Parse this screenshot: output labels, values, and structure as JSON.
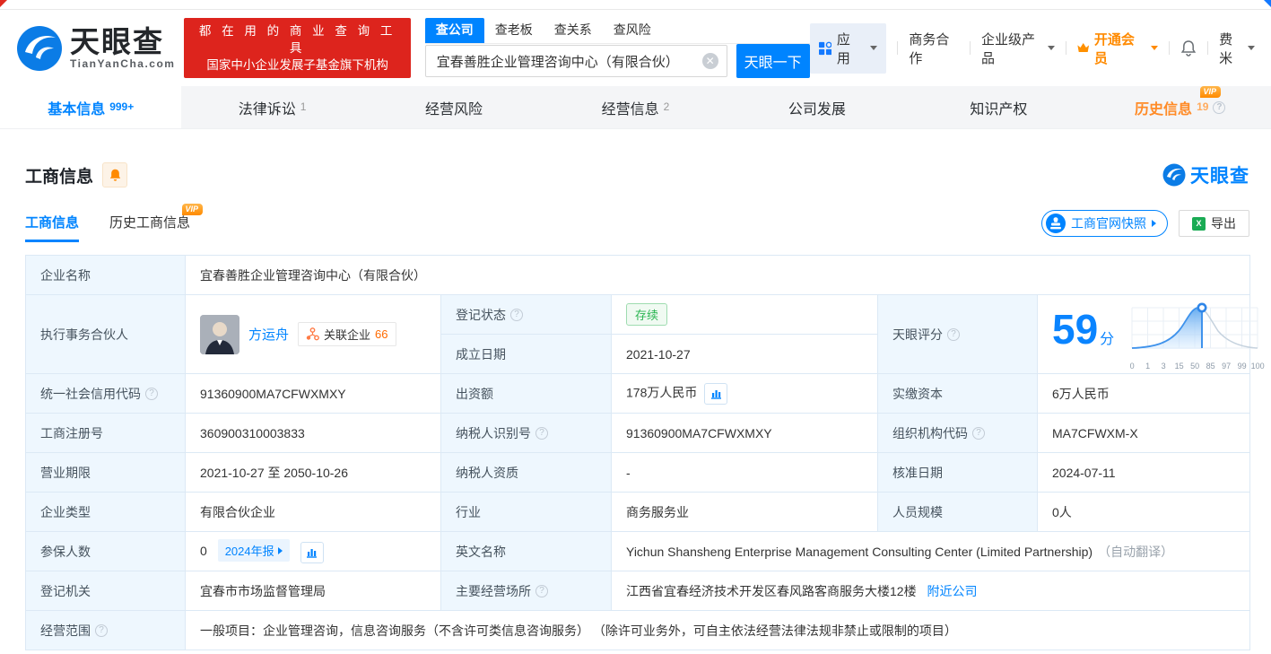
{
  "brand": {
    "name": "天眼查",
    "domain": "TianYanCha.com",
    "slogan_line1": "都 在 用 的 商 业 查 询 工 具",
    "slogan_line2": "国家中小企业发展子基金旗下机构"
  },
  "search": {
    "tabs": [
      {
        "label": "查公司"
      },
      {
        "label": "查老板"
      },
      {
        "label": "查关系"
      },
      {
        "label": "查风险"
      }
    ],
    "active_tab": "查公司",
    "value": "宜春善胜企业管理咨询中心（有限合伙）",
    "button": "天眼一下"
  },
  "topnav": {
    "apps": "应用",
    "cooperation": "商务合作",
    "enterprise_products": "企业级产品",
    "vip": "开通会员",
    "user": "费米"
  },
  "main_tabs": [
    {
      "label": "基本信息",
      "count": "999+"
    },
    {
      "label": "法律诉讼",
      "count": "1"
    },
    {
      "label": "经营风险",
      "count": ""
    },
    {
      "label": "经营信息",
      "count": "2"
    },
    {
      "label": "公司发展",
      "count": ""
    },
    {
      "label": "知识产权",
      "count": ""
    },
    {
      "label": "历史信息",
      "count": "19",
      "vip": "VIP"
    }
  ],
  "section": {
    "title": "工商信息",
    "subtabs": [
      {
        "label": "工商信息"
      },
      {
        "label": "历史工商信息",
        "vip": "VIP"
      }
    ],
    "snapshot_button": "工商官网快照",
    "export_button": "导出",
    "watermark": "天眼查"
  },
  "fields": {
    "company_name": {
      "label": "企业名称",
      "value": "宜春善胜企业管理咨询中心（有限合伙）"
    },
    "managing_partner": {
      "label": "执行事务合伙人",
      "name": "方运舟",
      "related_label": "关联企业",
      "related_count": "66"
    },
    "reg_status": {
      "label": "登记状态",
      "value": "存续"
    },
    "establish_date": {
      "label": "成立日期",
      "value": "2021-10-27"
    },
    "tyc_score": {
      "label": "天眼评分",
      "value": "59",
      "unit": "分"
    },
    "credit_code": {
      "label": "统一社会信用代码",
      "value": "91360900MA7CFWXMXY"
    },
    "capital": {
      "label": "出资额",
      "value": "178万人民币"
    },
    "paid_capital": {
      "label": "实缴资本",
      "value": "6万人民币"
    },
    "reg_number": {
      "label": "工商注册号",
      "value": "360900310003833"
    },
    "taxpayer_id": {
      "label": "纳税人识别号",
      "value": "91360900MA7CFWXMXY"
    },
    "org_code": {
      "label": "组织机构代码",
      "value": "MA7CFWXM-X"
    },
    "business_term": {
      "label": "营业期限",
      "value": "2021-10-27 至 2050-10-26"
    },
    "taxpayer_qualification": {
      "label": "纳税人资质",
      "value": "-"
    },
    "approval_date": {
      "label": "核准日期",
      "value": "2024-07-11"
    },
    "company_type": {
      "label": "企业类型",
      "value": "有限合伙企业"
    },
    "industry": {
      "label": "行业",
      "value": "商务服务业"
    },
    "staff_size": {
      "label": "人员规模",
      "value": "0人"
    },
    "insured_count": {
      "label": "参保人数",
      "value": "0",
      "report_tag": "2024年报"
    },
    "english_name": {
      "label": "英文名称",
      "value": "Yichun Shansheng Enterprise Management Consulting Center (Limited Partnership)",
      "note": "（自动翻译）"
    },
    "reg_authority": {
      "label": "登记机关",
      "value": "宜春市市场监督管理局"
    },
    "business_address": {
      "label": "主要经营场所",
      "value": "江西省宜春经济技术开发区春风路客商服务大楼12楼",
      "link": "附近公司"
    },
    "business_scope": {
      "label": "经营范围",
      "value": "一般项目：企业管理咨询，信息咨询服务（不含许可类信息咨询服务） （除许可业务外，可自主依法经营法律法规非禁止或限制的项目）"
    }
  },
  "score_chart": {
    "type": "area",
    "score": 59,
    "ticks": [
      "0",
      "1",
      "3",
      "15",
      "50",
      "85",
      "97",
      "99",
      "100"
    ],
    "accent_color": "#0084ff"
  },
  "colors": {
    "primary_blue": "#0084ff",
    "banner_red": "#dd241d",
    "vip_orange": "#ff8a00",
    "status_green": "#2bb552",
    "label_cell_bg": "#eef7fe",
    "table_border": "#dce9f5"
  }
}
